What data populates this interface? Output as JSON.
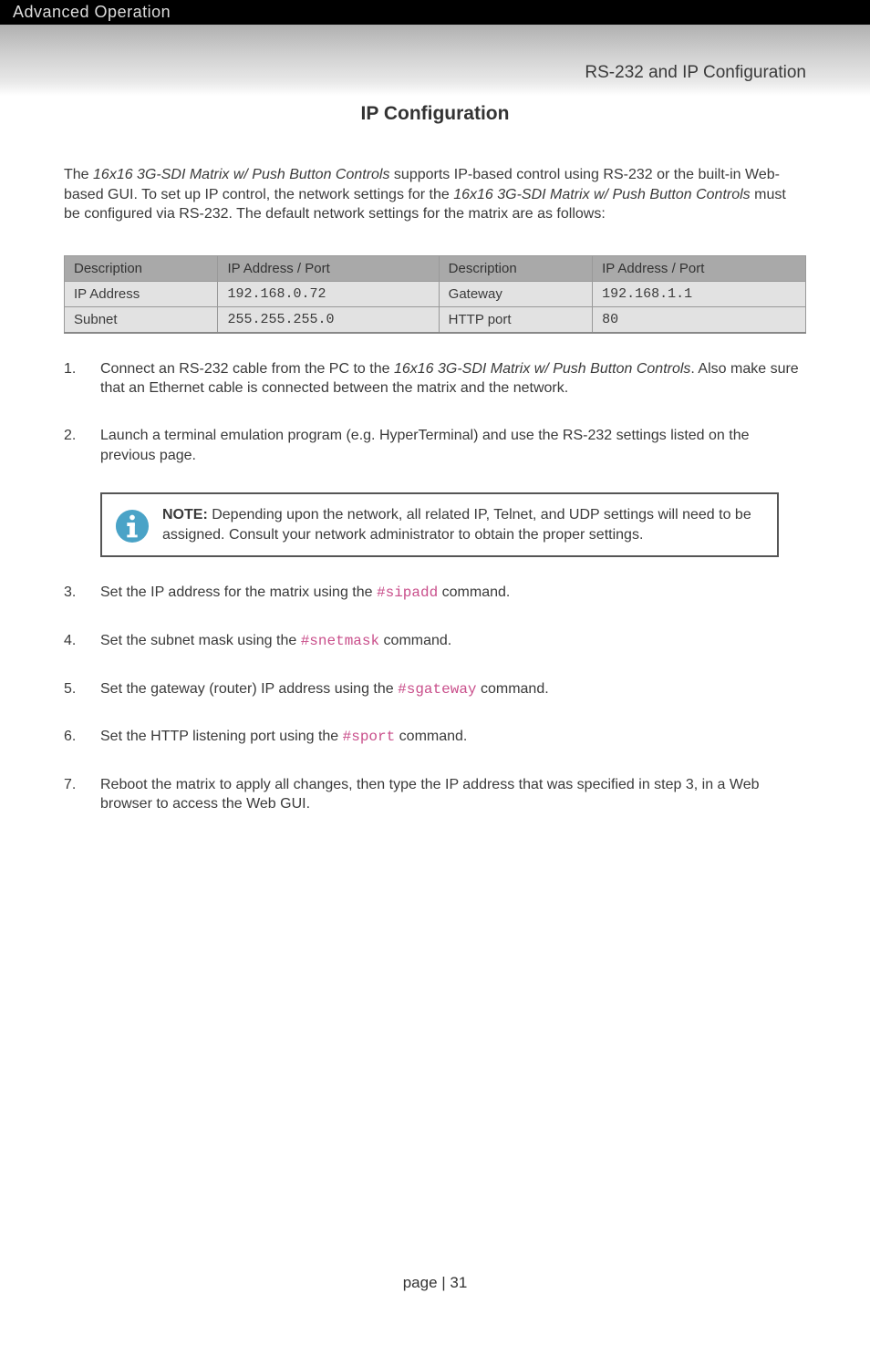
{
  "header": {
    "title": "Advanced Operation"
  },
  "subtitle": "RS-232 and IP Configuration",
  "page_heading": "IP Configuration",
  "intro": {
    "p1a": "The ",
    "p1b": "16x16 3G-SDI Matrix w/ Push Button Controls",
    "p1c": " supports IP-based control using RS-232 or the built-in Web-based GUI.  To set up IP control, the network settings for the ",
    "p1d": "16x16 3G-SDI Matrix w/ Push Button Controls",
    "p1e": " must be configured via RS-232.  The default network settings for the matrix are as follows:"
  },
  "table": {
    "h1": "Description",
    "h2": "IP Address / Port",
    "h3": "Description",
    "h4": "IP Address / Port",
    "r1c1": "IP Address",
    "r1c2": "192.168.0.72",
    "r1c3": "Gateway",
    "r1c4": "192.168.1.1",
    "r2c1": "Subnet",
    "r2c2": "255.255.255.0",
    "r2c3": "HTTP port",
    "r2c4": "80"
  },
  "steps": {
    "s1a": "Connect an RS-232 cable from the PC to the ",
    "s1b": "16x16 3G-SDI Matrix w/ Push Button Controls",
    "s1c": ".  Also make sure that an Ethernet cable is connected between the matrix and the network.",
    "s2": "Launch a terminal emulation program (e.g. HyperTerminal) and use the RS-232 settings listed on the previous page.",
    "s3a": "Set the IP address for the matrix using the ",
    "s3cmd": "#sipadd",
    "s3b": " command.",
    "s4a": "Set the subnet mask using the ",
    "s4cmd": "#snetmask",
    "s4b": " command.",
    "s5a": "Set the gateway (router) IP address using the ",
    "s5cmd": "#sgateway",
    "s5b": " command.",
    "s6a": "Set the HTTP listening port using the ",
    "s6cmd": "#sport",
    "s6b": " command.",
    "s7": "Reboot the matrix to apply all changes, then type the IP address that was specified in step 3, in a Web browser to access the Web GUI."
  },
  "note": {
    "label": "NOTE:",
    "body": " Depending upon the network, all related IP, Telnet, and UDP settings will need to be assigned.  Consult your network administrator to obtain the proper settings."
  },
  "footer": "page | 31"
}
